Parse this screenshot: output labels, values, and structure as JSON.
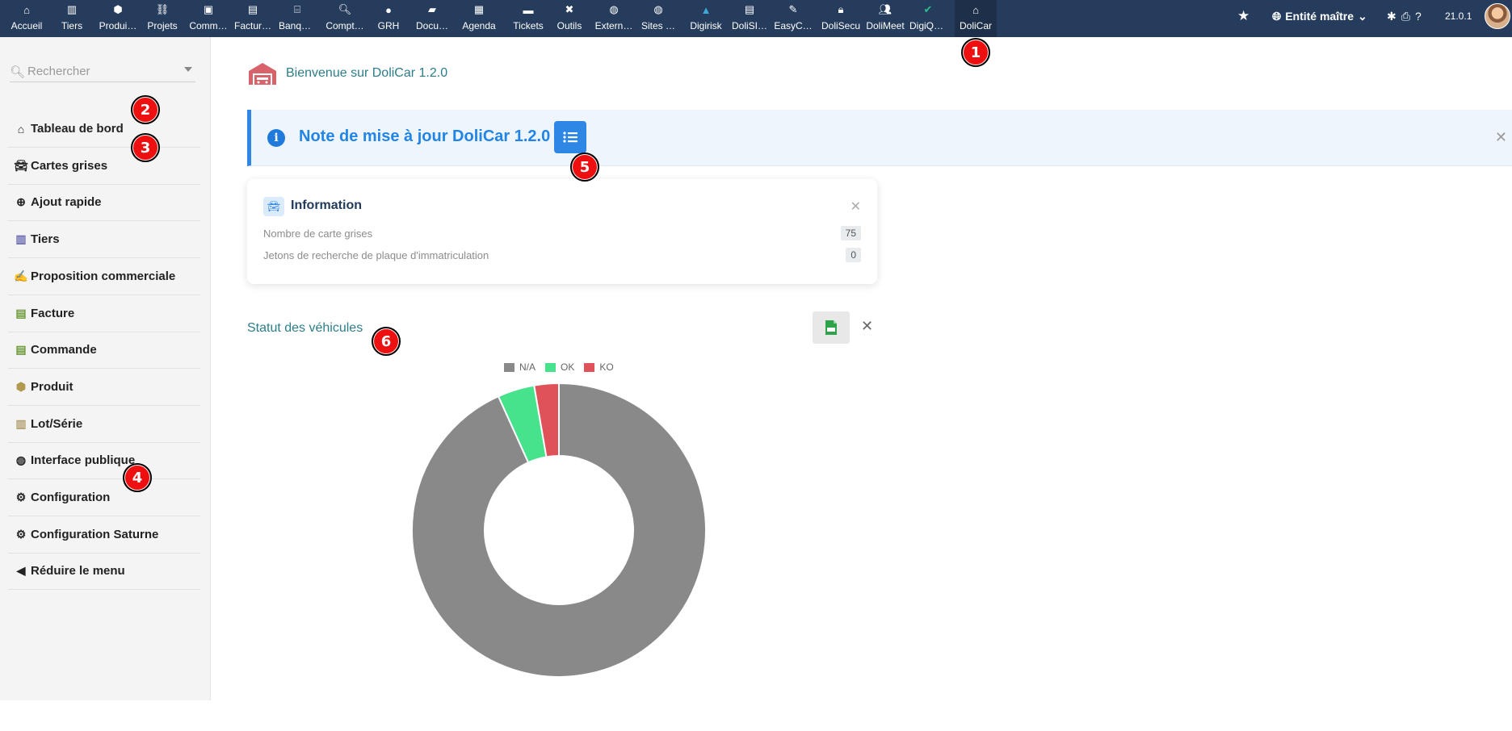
{
  "topbar": {
    "menu": [
      {
        "label": "Accueil",
        "icon": "home-icon"
      },
      {
        "label": "Tiers",
        "icon": "building-icon"
      },
      {
        "label": "Produi…",
        "icon": "cube-icon"
      },
      {
        "label": "Projets",
        "icon": "sitemap-icon"
      },
      {
        "label": "Comm…",
        "icon": "briefcase-icon"
      },
      {
        "label": "Factur…",
        "icon": "file-invoice-icon"
      },
      {
        "label": "Banqu…",
        "icon": "bank-icon"
      },
      {
        "label": "Compt…",
        "icon": "search-dollar-icon"
      },
      {
        "label": "GRH",
        "icon": "user-tie-icon"
      },
      {
        "label": "Docu…",
        "icon": "folder-open-icon"
      },
      {
        "label": "Agenda",
        "icon": "calendar-icon"
      },
      {
        "label": "Tickets",
        "icon": "ticket-icon"
      },
      {
        "label": "Outils",
        "icon": "tools-icon"
      },
      {
        "label": "Extern…",
        "icon": "globe-icon"
      },
      {
        "label": "Sites …",
        "icon": "globe-icon"
      },
      {
        "label": "Digirisk",
        "icon": "digirisk-logo-icon"
      },
      {
        "label": "DoliSI…",
        "icon": "id-card-icon"
      },
      {
        "label": "EasyC…",
        "icon": "easycrm-icon"
      },
      {
        "label": "DoliSecu",
        "icon": "lock-icon"
      },
      {
        "label": "DoliMeet",
        "icon": "users-icon"
      },
      {
        "label": "DigiQuali",
        "icon": "digiquali-logo-icon"
      },
      {
        "label": "DoliCar",
        "icon": "garage-icon"
      }
    ],
    "entity": "Entité maître",
    "version": "21.0.1"
  },
  "sidebar": {
    "search_placeholder": "Rechercher",
    "items": [
      {
        "label": "Tableau de bord",
        "icon": "home-icon"
      },
      {
        "label": "Cartes grises",
        "icon": "car-icon"
      },
      {
        "label": "Ajout rapide",
        "icon": "plus-circle-icon"
      },
      {
        "label": "Tiers",
        "icon": "building-icon"
      },
      {
        "label": "Proposition commerciale",
        "icon": "file-signature-icon"
      },
      {
        "label": "Facture",
        "icon": "file-invoice-icon"
      },
      {
        "label": "Commande",
        "icon": "file-alt-icon"
      },
      {
        "label": "Produit",
        "icon": "cube-icon"
      },
      {
        "label": "Lot/Série",
        "icon": "barcode-icon"
      },
      {
        "label": "Interface publique",
        "icon": "globe-icon"
      },
      {
        "label": "Configuration",
        "icon": "gear-icon"
      },
      {
        "label": "Configuration Saturne",
        "icon": "gear-icon"
      },
      {
        "label": "Réduire le menu",
        "icon": "chevron-circle-left-icon"
      }
    ]
  },
  "main": {
    "welcome": "Bienvenue sur DoliCar 1.2.0",
    "update_note": "Note de mise à jour DoliCar 1.2.0",
    "info_card": {
      "title": "Information",
      "rows": [
        {
          "label": "Nombre de carte grises",
          "value": "75"
        },
        {
          "label": "Jetons de recherche de plaque d'immatriculation",
          "value": "0"
        }
      ]
    },
    "chart_title": "Statut des véhicules"
  },
  "markers": [
    "1",
    "2",
    "3",
    "4",
    "5",
    "6"
  ],
  "chart_data": {
    "type": "pie",
    "title": "Statut des véhicules",
    "categories": [
      "N/A",
      "OK",
      "KO"
    ],
    "values": [
      69,
      3,
      2
    ],
    "colors": [
      "#898989",
      "#46e28c",
      "#e0525a"
    ],
    "legend_placement": "top"
  }
}
